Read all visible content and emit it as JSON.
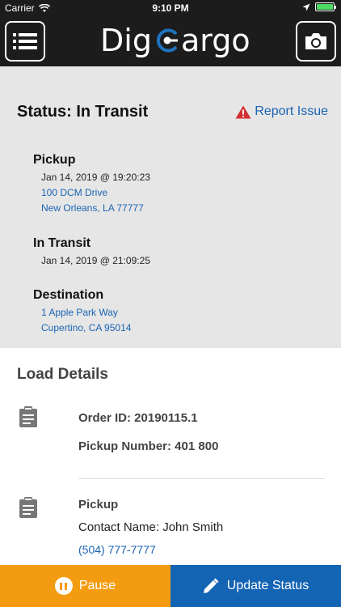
{
  "status_bar": {
    "carrier": "Carrier",
    "time": "9:10 PM",
    "battery_color": "#4cd964"
  },
  "header": {
    "logo_left": "Dig",
    "logo_right": "argo",
    "menu_icon": "list-icon",
    "camera_icon": "camera-icon",
    "brand_color": "#1e73be"
  },
  "status": {
    "title": "Status: In Transit",
    "report_label": "Report Issue",
    "warning_color": "#d32f2f"
  },
  "stages": {
    "pickup": {
      "name": "Pickup",
      "timestamp": "Jan 14, 2019 @ 19:20:23",
      "address_line1": "100 DCM Drive",
      "address_line2": "New Orleans, LA 77777"
    },
    "in_transit": {
      "name": "In Transit",
      "timestamp": "Jan 14, 2019 @ 21:09:25"
    },
    "destination": {
      "name": "Destination",
      "address_line1": "1 Apple Park Way",
      "address_line2": "Cupertino, CA 95014"
    }
  },
  "load_details": {
    "title": "Load Details",
    "order_id": "Order ID: 20190115.1",
    "pickup_number": "Pickup Number: 401 800",
    "pickup_heading": "Pickup",
    "contact_name": "Contact Name: John Smith",
    "phone": "(504) 777-7777"
  },
  "actions": {
    "pause_label": "Pause",
    "update_label": "Update Status",
    "pause_color": "#f39c12",
    "update_color": "#1464b4"
  }
}
